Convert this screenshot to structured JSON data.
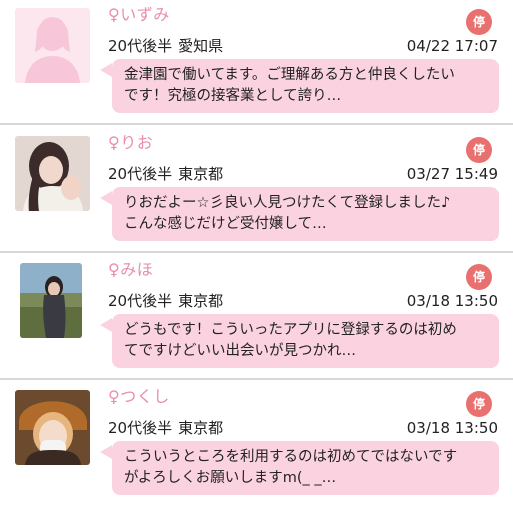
{
  "users": [
    {
      "name": "♀いずみ",
      "age": "20代後半",
      "area": "愛知県",
      "datetime": "04/22 17:07",
      "message_line1": "金津園で働いてます。ご理解ある方と仲良くしたい",
      "message_line2": "です！究極の接客業として誇り…",
      "badge": "停"
    },
    {
      "name": "♀りお",
      "age": "20代後半",
      "area": "東京都",
      "datetime": "03/27 15:49",
      "message_line1": "りおだよー☆彡良い人見つけたくて登録しました♪",
      "message_line2": "こんな感じだけど受付嬢して…",
      "badge": "停"
    },
    {
      "name": "♀みほ",
      "age": "20代後半",
      "area": "東京都",
      "datetime": "03/18 13:50",
      "message_line1": "どうもです！こういったアプリに登録するのは初め",
      "message_line2": "てですけどいい出会いが見つかれ…",
      "badge": "停"
    },
    {
      "name": "♀つくし",
      "age": "20代後半",
      "area": "東京都",
      "datetime": "03/18 13:50",
      "message_line1": "こういうところを利用するのは初めてではないです",
      "message_line2": "がよろしくお願いしますm(_ _…",
      "badge": "停"
    }
  ],
  "colors": {
    "name_pink": "#e88eae",
    "bubble_pink": "#fbd3e0",
    "badge_red": "#e8706f",
    "divider_gray": "#d9d9d9"
  }
}
